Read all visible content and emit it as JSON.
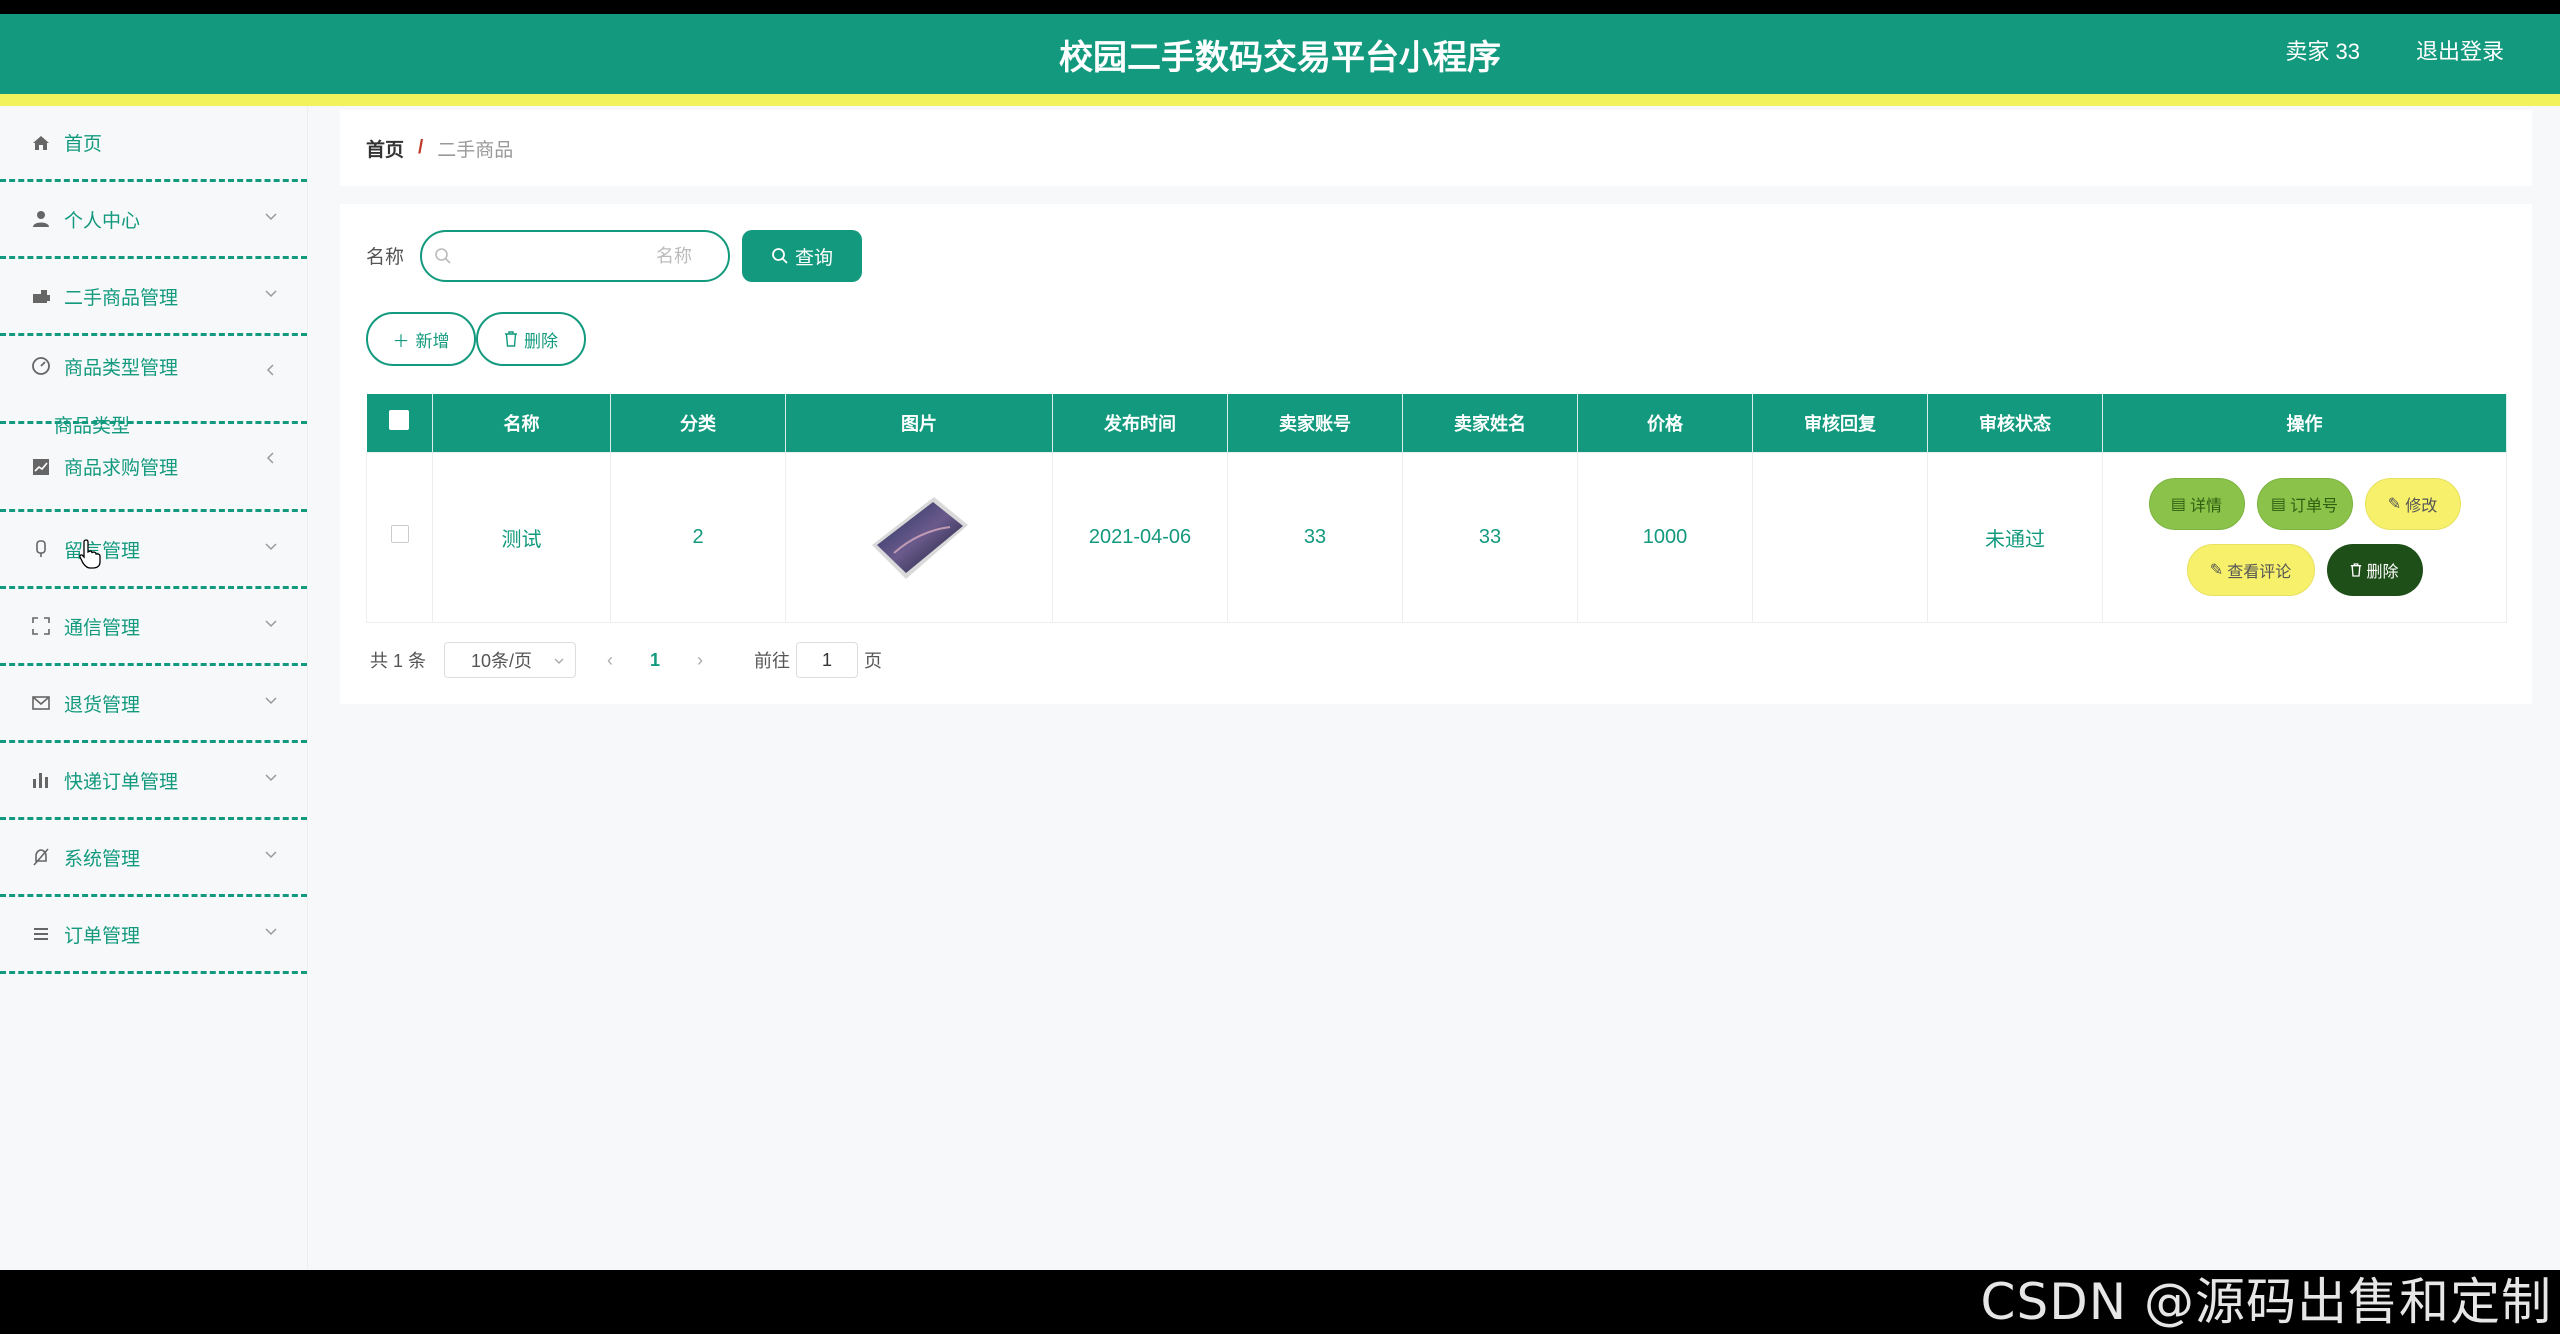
{
  "header": {
    "title": "校园二手数码交易平台小程序",
    "user": "卖家 33",
    "logout": "退出登录"
  },
  "colors": {
    "primary": "#139a7e",
    "stripe": "#f2f25c"
  },
  "sidebar": {
    "items": [
      {
        "label": "首页",
        "icon": "home-icon"
      },
      {
        "label": "个人中心",
        "icon": "user-icon"
      },
      {
        "label": "二手商品管理",
        "icon": "goods-icon"
      },
      {
        "label": "商品类型管理",
        "icon": "dashboard-icon"
      },
      {
        "label": "商品求购管理",
        "icon": "chart-icon"
      },
      {
        "label": "留言管理",
        "icon": "mic-icon"
      },
      {
        "label": "通信管理",
        "icon": "fullscreen-icon"
      },
      {
        "label": "退货管理",
        "icon": "mail-icon"
      },
      {
        "label": "快递订单管理",
        "icon": "bar-chart-icon"
      },
      {
        "label": "系统管理",
        "icon": "bell-off-icon"
      },
      {
        "label": "订单管理",
        "icon": "list-icon"
      }
    ],
    "subitem": "商品类型"
  },
  "breadcrumb": {
    "home": "首页",
    "sep": "/",
    "current": "二手商品"
  },
  "search": {
    "label": "名称",
    "placeholder": "名称",
    "button": "查询"
  },
  "actions": {
    "add": "新增",
    "delete": "删除"
  },
  "table": {
    "columns": [
      "名称",
      "分类",
      "图片",
      "发布时间",
      "卖家账号",
      "卖家姓名",
      "价格",
      "审核回复",
      "审核状态",
      "操作"
    ],
    "rows": [
      {
        "name": "测试",
        "category": "2",
        "date": "2021-04-06",
        "account": "33",
        "seller": "33",
        "price": "1000",
        "reply": "",
        "status": "未通过"
      }
    ],
    "ops": {
      "detail": "详情",
      "order_no": "订单号",
      "edit": "修改",
      "comments": "查看评论",
      "delete": "删除"
    }
  },
  "pager": {
    "total": "共 1 条",
    "size": "10条/页",
    "page": "1",
    "goto": "前往",
    "goto_value": "1",
    "suffix": "页"
  },
  "watermark": "CSDN @源码出售和定制"
}
